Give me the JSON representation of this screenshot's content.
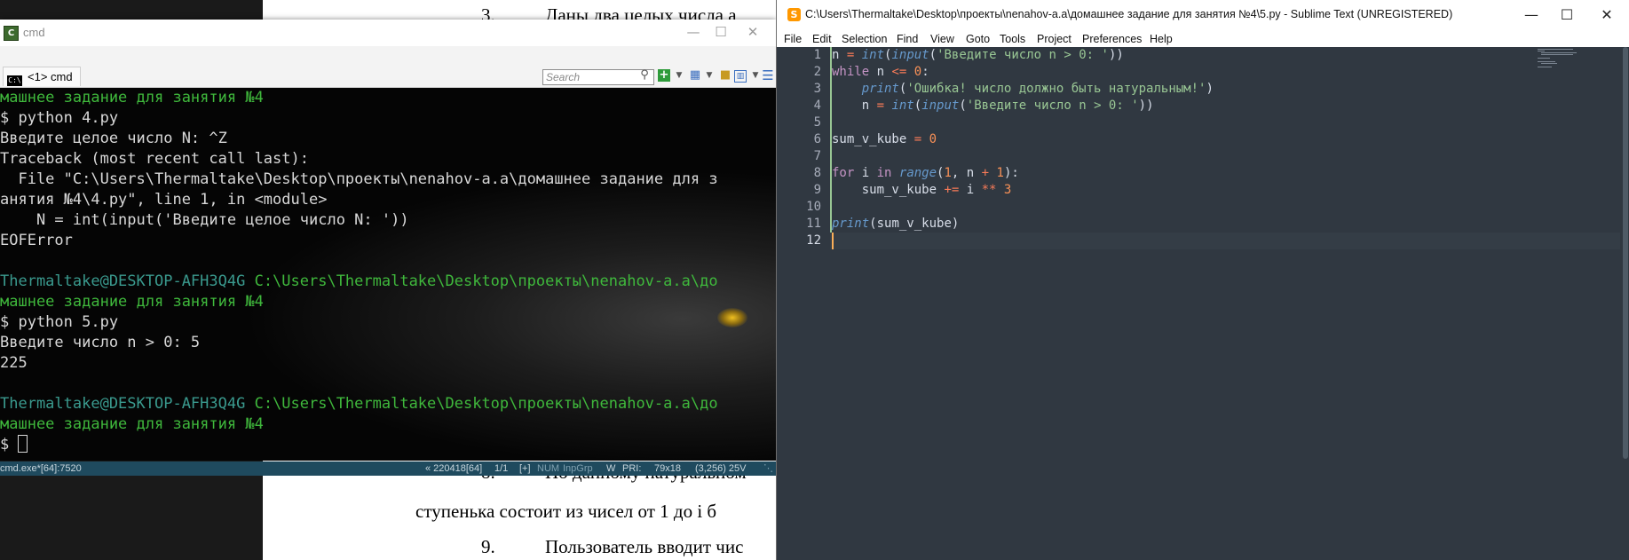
{
  "document": {
    "lines": [
      {
        "num": "3.",
        "text": "Даны два целых числа a"
      },
      {
        "num": "8.",
        "text": "По данному натуральном"
      },
      {
        "num": "",
        "text": "ступенька состоит из чисел от 1 до i б"
      },
      {
        "num": "9.",
        "text": "Пользователь вводит чис"
      }
    ]
  },
  "cmd": {
    "title": "cmd",
    "tab_label": "<1> cmd",
    "search_placeholder": "Search",
    "terminal_lines": [
      {
        "text": "машнее задание для занятия №4",
        "color": "green"
      },
      {
        "text": "$ python 4.py",
        "color": "white"
      },
      {
        "text": "Введите целое число N: ^Z",
        "color": "white"
      },
      {
        "text": "Traceback (most recent call last):",
        "color": "white"
      },
      {
        "text": "  File \"C:\\Users\\Thermaltake\\Desktop\\проекты\\nenahov-a.a\\домашнее задание для з",
        "color": "white"
      },
      {
        "text": "анятия №4\\4.py\", line 1, in <module>",
        "color": "white"
      },
      {
        "text": "    N = int(input('Введите целое число N: '))",
        "color": "white"
      },
      {
        "text": "EOFError",
        "color": "white"
      },
      {
        "text": "",
        "color": "white"
      },
      {
        "prompt_user": "Thermaltake@DESKTOP-AFH3Q4G",
        "prompt_path": " C:\\Users\\Thermaltake\\Desktop\\проекты\\nenahov-a.a\\до"
      },
      {
        "text": "машнее задание для занятия №4",
        "color": "green"
      },
      {
        "text": "$ python 5.py",
        "color": "white"
      },
      {
        "text": "Введите число n > 0: 5",
        "color": "white"
      },
      {
        "text": "225",
        "color": "white"
      },
      {
        "text": "",
        "color": "white"
      },
      {
        "prompt_user": "Thermaltake@DESKTOP-AFH3Q4G",
        "prompt_path": " C:\\Users\\Thermaltake\\Desktop\\проекты\\nenahov-a.a\\до"
      },
      {
        "text": "машнее задание для занятия №4",
        "color": "green"
      },
      {
        "text": "$ ",
        "color": "white",
        "cursor": true
      }
    ],
    "status": {
      "process": "cmd.exe*[64]:7520",
      "pid": "« 220418[64]",
      "pos": "1/1",
      "flags": "[+]",
      "num": "NUM",
      "inpgrp": "InpGrp",
      "w": "W",
      "pri": "PRI:",
      "size": "79x18",
      "cursor": "(3,256) 25V"
    }
  },
  "sublime": {
    "title": "C:\\Users\\Thermaltake\\Desktop\\проекты\\nenahov-a.a\\домашнее задание для занятия №4\\5.py - Sublime Text (UNREGISTERED)",
    "menu": [
      "File",
      "Edit",
      "Selection",
      "Find",
      "View",
      "Goto",
      "Tools",
      "Project",
      "Preferences",
      "Help"
    ],
    "line_numbers": [
      "1",
      "2",
      "3",
      "4",
      "5",
      "6",
      "7",
      "8",
      "9",
      "10",
      "11",
      "12"
    ],
    "active_line": "12"
  }
}
